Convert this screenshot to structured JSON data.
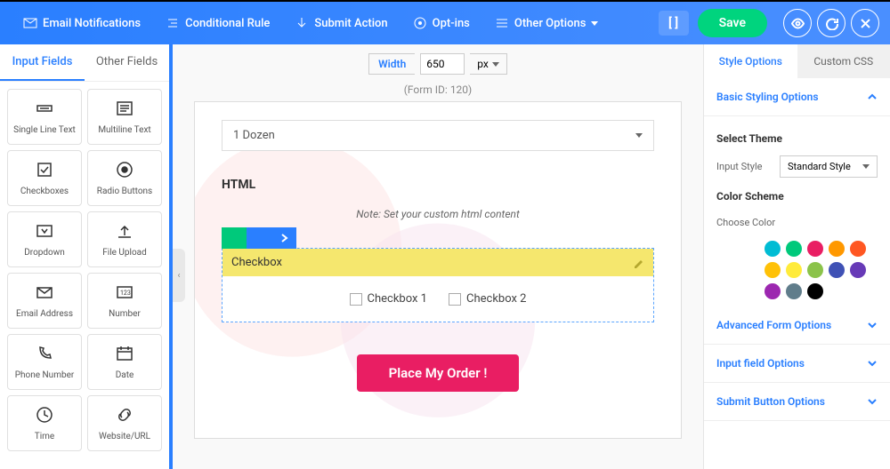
{
  "topmenu": {
    "email": "Email Notifications",
    "conditional": "Conditional Rule",
    "submit": "Submit Action",
    "optins": "Opt-ins",
    "other": "Other Options",
    "save": "Save"
  },
  "left": {
    "tab_input": "Input Fields",
    "tab_other": "Other Fields",
    "items": [
      {
        "label": "Single Line Text"
      },
      {
        "label": "Multiline Text"
      },
      {
        "label": "Checkboxes"
      },
      {
        "label": "Radio Buttons"
      },
      {
        "label": "Dropdown"
      },
      {
        "label": "File Upload"
      },
      {
        "label": "Email Address"
      },
      {
        "label": "Number"
      },
      {
        "label": "Phone Number"
      },
      {
        "label": "Date"
      },
      {
        "label": "Time"
      },
      {
        "label": "Website/URL"
      }
    ]
  },
  "canvas": {
    "width_label": "Width",
    "width_value": "650",
    "width_unit": "px",
    "form_id": "(Form ID: 120)",
    "dropdown_value": "1 Dozen",
    "html_label": "HTML",
    "html_note": "Note: Set your custom html content",
    "checkbox_title": "Checkbox",
    "cb1": "Checkbox 1",
    "cb2": "Checkbox 2",
    "submit_label": "Place My Order !"
  },
  "right": {
    "tab_style": "Style Options",
    "tab_css": "Custom CSS",
    "basic": "Basic Styling Options",
    "select_theme": "Select Theme",
    "input_style_label": "Input Style",
    "input_style_value": "Standard Style",
    "color_scheme": "Color Scheme",
    "choose_color": "Choose Color",
    "advanced": "Advanced Form Options",
    "inputfield": "Input field Options",
    "submitbtn": "Submit Button Options",
    "colors": [
      "#00bcd4",
      "#00c97b",
      "#e91e63",
      "#ff9800",
      "#ff5722",
      "#ffc107",
      "#ffeb3b",
      "#8bc34a",
      "#3f51b5",
      "#673ab7",
      "#9c27b0",
      "#607d8b",
      "#000000"
    ]
  }
}
